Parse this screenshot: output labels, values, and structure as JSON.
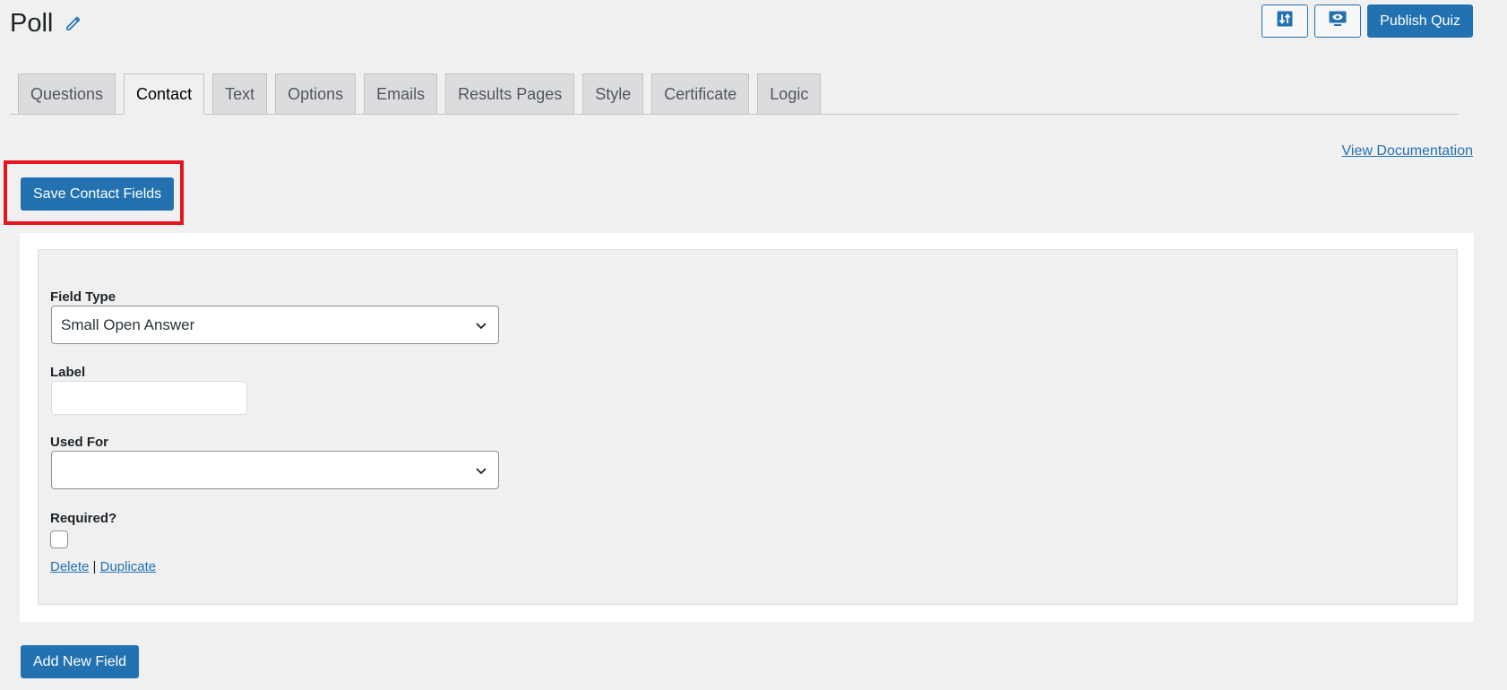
{
  "header": {
    "title": "Poll",
    "publish_label": "Publish Quiz",
    "icons": [
      "edit-pencil-icon",
      "sort-arrows-icon",
      "preview-screen-icon"
    ]
  },
  "tabs": [
    {
      "label": "Questions",
      "active": false
    },
    {
      "label": "Contact",
      "active": true
    },
    {
      "label": "Text",
      "active": false
    },
    {
      "label": "Options",
      "active": false
    },
    {
      "label": "Emails",
      "active": false
    },
    {
      "label": "Results Pages",
      "active": false
    },
    {
      "label": "Style",
      "active": false
    },
    {
      "label": "Certificate",
      "active": false
    },
    {
      "label": "Logic",
      "active": false
    }
  ],
  "doc_link": "View Documentation",
  "save_label": "Save Contact Fields",
  "field": {
    "type_label": "Field Type",
    "type_value": "Small Open Answer",
    "label_label": "Label",
    "label_value": "",
    "used_for_label": "Used For",
    "used_for_value": "",
    "required_label": "Required?",
    "required_checked": false,
    "delete_label": "Delete",
    "separator": "|",
    "duplicate_label": "Duplicate"
  },
  "add_label": "Add New Field",
  "colors": {
    "primary": "#2271b1",
    "highlight": "#e5141f",
    "background": "#f0f0f1"
  }
}
